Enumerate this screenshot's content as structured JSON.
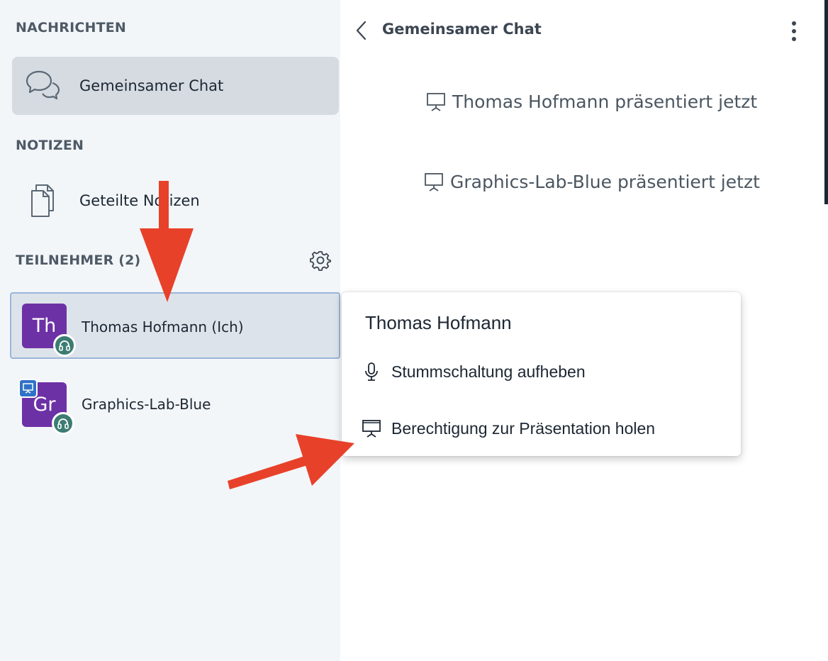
{
  "sidebar": {
    "messages_title": "NACHRICHTEN",
    "public_chat_label": "Gemeinsamer Chat",
    "notes_title": "NOTIZEN",
    "shared_notes_label": "Geteilte Notizen",
    "participants_title": "TEILNEHMER (2)",
    "users": [
      {
        "initials": "Th",
        "name": "Thomas Hofmann (Ich)",
        "audio": "headphones-icon",
        "presenter": false,
        "avatar_color": "#6d31a6"
      },
      {
        "initials": "Gr",
        "name": "Graphics-Lab-Blue",
        "audio": "headphones-icon",
        "presenter": true,
        "avatar_color": "#6d31a6"
      }
    ]
  },
  "chat": {
    "title": "Gemeinsamer Chat",
    "messages": [
      "Thomas Hofmann präsentiert jetzt",
      "Graphics-Lab-Blue präsentiert jetzt"
    ]
  },
  "popup": {
    "title": "Thomas Hofmann",
    "items": [
      {
        "label": "Stummschaltung aufheben",
        "icon": "microphone-icon"
      },
      {
        "label": "Berechtigung zur Präsentation holen",
        "icon": "presentation-icon"
      }
    ]
  },
  "colors": {
    "sidebar_bg": "#f3f6f9",
    "avatar": "#6d31a6",
    "audio_badge": "#3c7c72",
    "presenter_badge": "#2f72c7",
    "annotation_arrow": "#e8412a"
  }
}
